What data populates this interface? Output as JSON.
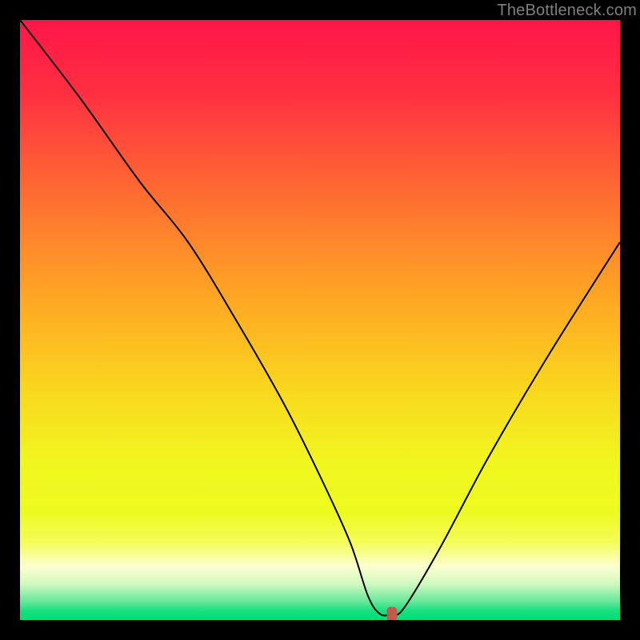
{
  "watermark": "TheBottleneck.com",
  "colors": {
    "page_bg": "#000000",
    "watermark": "#7f7f7f",
    "curve": "#000000",
    "marker_fill": "#c35a4d",
    "gradient_stops": [
      {
        "offset": 0.0,
        "color": "#ff1648"
      },
      {
        "offset": 0.12,
        "color": "#ff2f42"
      },
      {
        "offset": 0.25,
        "color": "#ff5e35"
      },
      {
        "offset": 0.38,
        "color": "#ff8b2a"
      },
      {
        "offset": 0.5,
        "color": "#feb321"
      },
      {
        "offset": 0.62,
        "color": "#f9d81e"
      },
      {
        "offset": 0.74,
        "color": "#f0f71f"
      },
      {
        "offset": 0.82,
        "color": "#edfa20"
      },
      {
        "offset": 0.87,
        "color": "#f4fd57"
      },
      {
        "offset": 0.91,
        "color": "#fdffce"
      },
      {
        "offset": 0.94,
        "color": "#d1f8c1"
      },
      {
        "offset": 0.968,
        "color": "#6be89b"
      },
      {
        "offset": 0.985,
        "color": "#17e07f"
      },
      {
        "offset": 1.0,
        "color": "#00de79"
      }
    ]
  },
  "chart_data": {
    "type": "line",
    "title": "",
    "xlabel": "",
    "ylabel": "",
    "xlim": [
      0,
      100
    ],
    "ylim": [
      0,
      100
    ],
    "series": [
      {
        "name": "bottleneck-curve",
        "x": [
          0,
          10,
          20,
          28,
          36,
          44,
          50,
          55,
          58,
          60,
          62,
          64,
          70,
          78,
          88,
          100
        ],
        "y": [
          100,
          87,
          73,
          63,
          50,
          36,
          24,
          13,
          4,
          1,
          1,
          2,
          12,
          27,
          44,
          63
        ]
      }
    ],
    "marker": {
      "x": 62,
      "y": 1
    }
  }
}
